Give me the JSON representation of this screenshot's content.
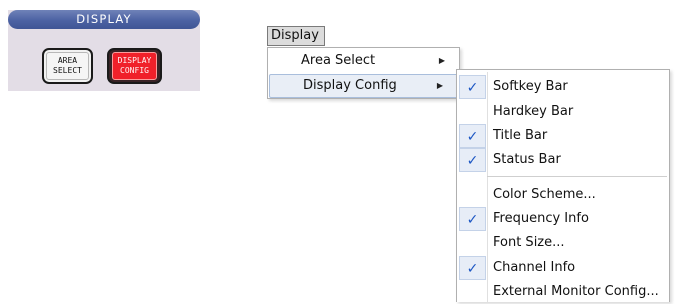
{
  "hardkey_panel": {
    "title": "DISPLAY",
    "buttons": [
      {
        "line1": "AREA",
        "line2": "SELECT"
      },
      {
        "line1": "DISPLAY",
        "line2": "CONFIG"
      }
    ]
  },
  "menubar": {
    "display_label": "Display"
  },
  "main_menu": {
    "items": [
      {
        "label": "Area Select",
        "submenu": true
      },
      {
        "label": "Display Config",
        "submenu": true
      }
    ]
  },
  "sub_menu": {
    "items": [
      {
        "label": "Softkey Bar",
        "checked": true
      },
      {
        "label": "Hardkey Bar",
        "checked": false
      },
      {
        "label": "Title Bar",
        "checked": true
      },
      {
        "label": "Status Bar",
        "checked": true
      },
      {
        "label": "Color Scheme...",
        "checked": false
      },
      {
        "label": "Frequency Info",
        "checked": true
      },
      {
        "label": "Font Size...",
        "checked": false
      },
      {
        "label": "Channel Info",
        "checked": true
      },
      {
        "label": "External Monitor Config...",
        "checked": false
      }
    ],
    "check_glyph": "✓"
  },
  "colors": {
    "header_blue": "#4c62a3",
    "active_key_red": "#f0202a",
    "check_blue": "#1d57c4",
    "highlight": "#e9eef6"
  }
}
